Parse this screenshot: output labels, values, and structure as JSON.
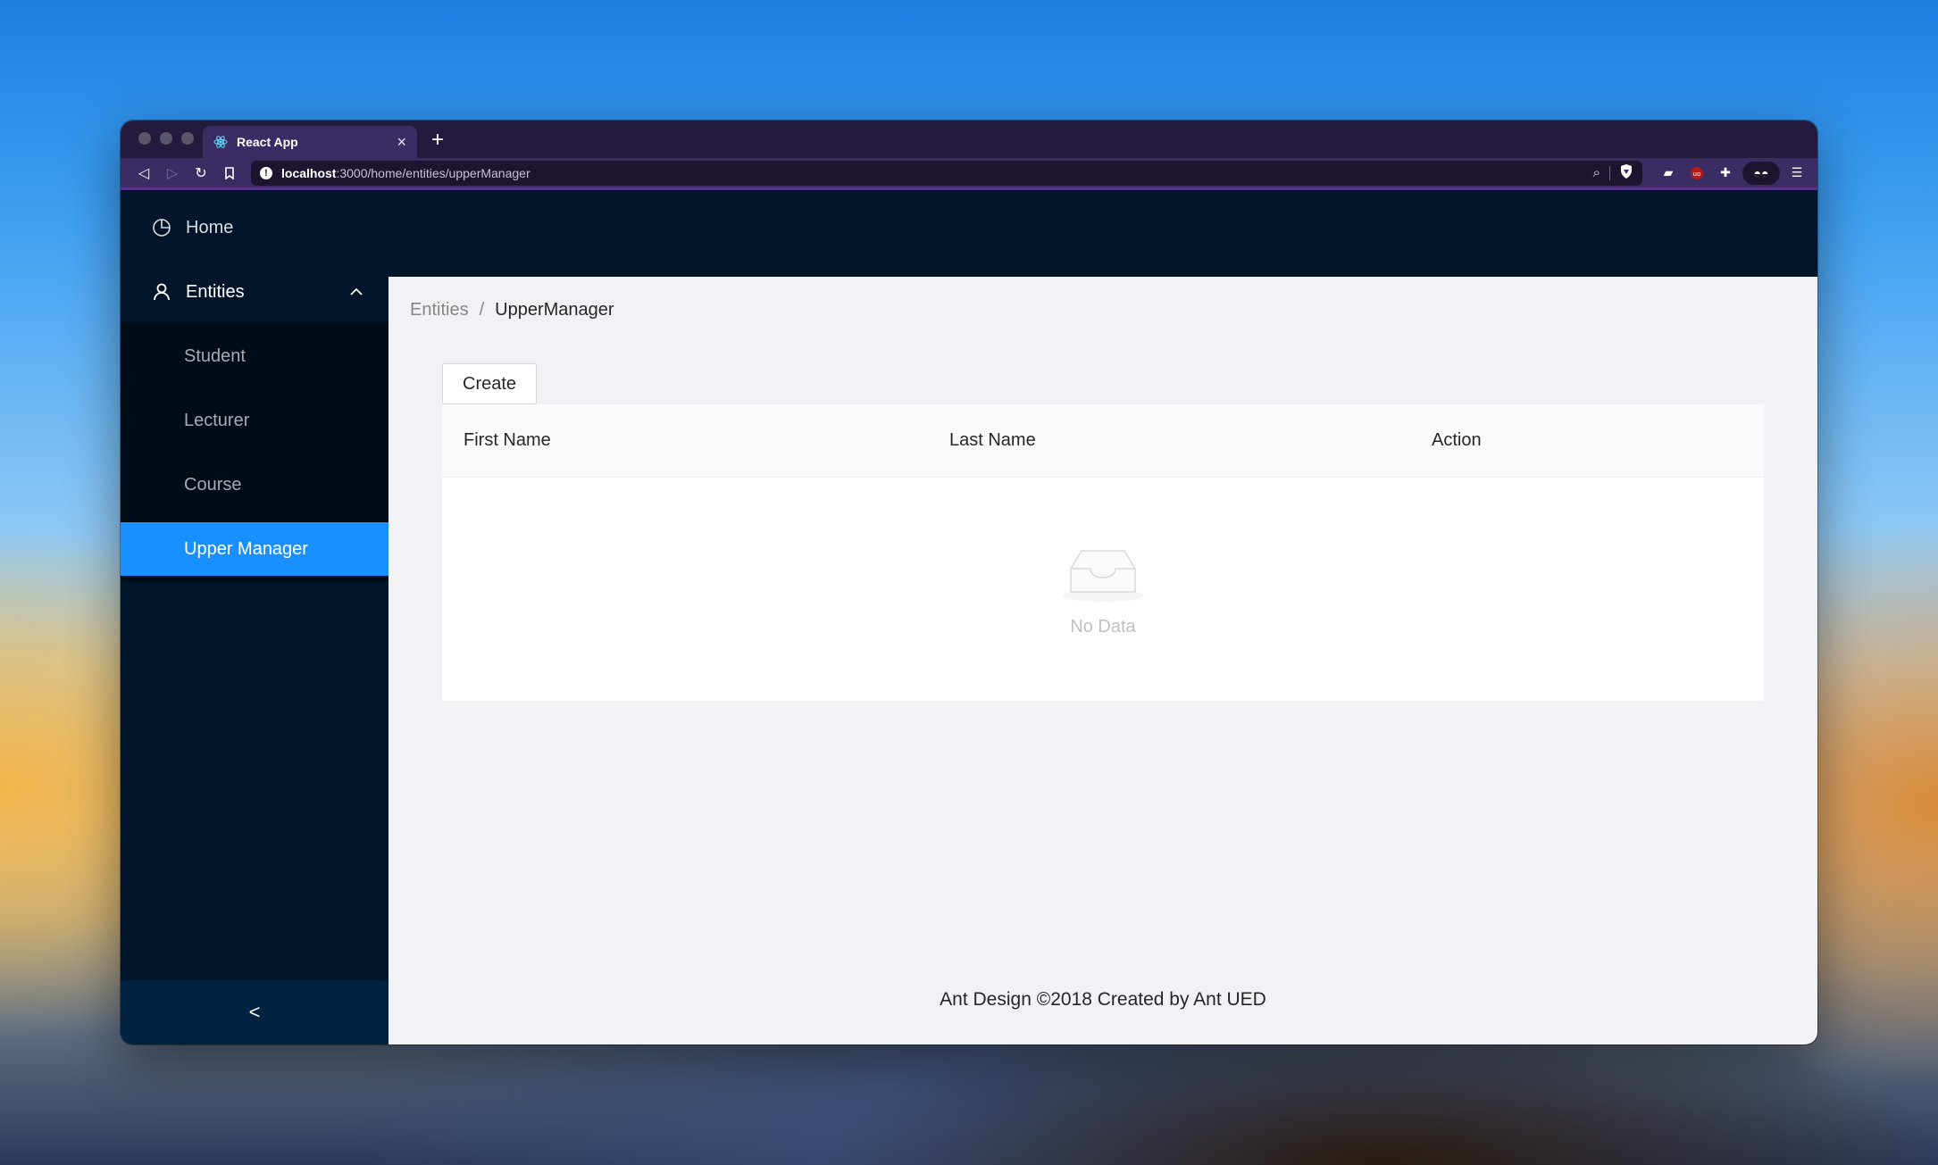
{
  "browser": {
    "tab_title": "React App",
    "url_host": "localhost",
    "url_path": ":3000/home/entities/upperManager"
  },
  "sidebar": {
    "items": [
      {
        "label": "Home",
        "icon": "pie-chart-icon"
      },
      {
        "label": "Entities",
        "icon": "user-icon",
        "expanded": true,
        "children": [
          {
            "label": "Student"
          },
          {
            "label": "Lecturer"
          },
          {
            "label": "Course"
          },
          {
            "label": "Upper Manager",
            "active": true
          }
        ]
      }
    ],
    "collapse_icon": "<"
  },
  "breadcrumb": {
    "parent": "Entities",
    "separator": "/",
    "current": "UpperManager"
  },
  "toolbar": {
    "create_label": "Create"
  },
  "table": {
    "columns": [
      "First Name",
      "Last Name",
      "Action"
    ],
    "rows": [],
    "empty_text": "No Data"
  },
  "footer": {
    "text": "Ant Design ©2018 Created by Ant UED"
  },
  "colors": {
    "sider_bg": "#001529",
    "submenu_bg": "#000c17",
    "active_item": "#1890ff",
    "content_bg": "#f0f2f5"
  }
}
